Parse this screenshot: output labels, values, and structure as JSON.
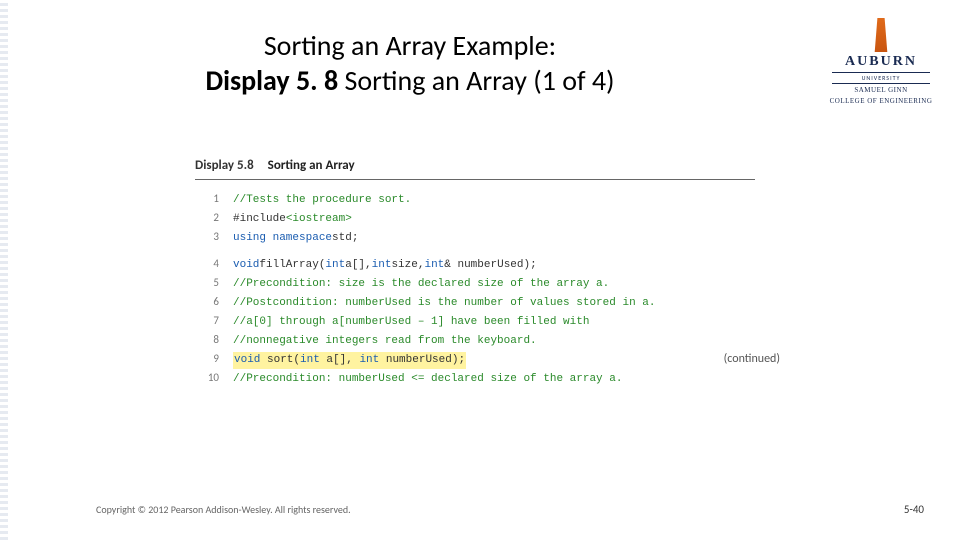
{
  "title": {
    "line1": "Sorting an Array Example:",
    "bold": "Display 5. 8",
    "rest": "  Sorting an Array (1 of 4)"
  },
  "logo": {
    "word": "AUBURN",
    "sub1": "UNIVERSITY",
    "sub2a": "SAMUEL GINN",
    "sub2b": "COLLEGE OF ENGINEERING"
  },
  "display": {
    "label": "Display 5.8",
    "name": "Sorting an Array"
  },
  "code": {
    "l1": "//Tests the procedure sort.",
    "l2a": "#include ",
    "l2b": "<iostream>",
    "l3a": "using namespace",
    "l3b": " std;",
    "l4a": "void",
    "l4b": " fillArray(",
    "l4c": "int",
    "l4d": " a[], ",
    "l4e": "int",
    "l4f": " size, ",
    "l4g": "int",
    "l4h": "& numberUsed);",
    "l5": "//Precondition: size is the declared size of the array a.",
    "l6": "//Postcondition: numberUsed is the number of values stored in a.",
    "l7": "//a[0] through a[numberUsed – 1] have been filled with",
    "l8": "//nonnegative integers read from the keyboard.",
    "l9a": "void",
    "l9b": " sort(",
    "l9c": "int",
    "l9d": " a[], ",
    "l9e": "int",
    "l9f": " numberUsed);",
    "l10": "//Precondition: numberUsed <= declared size of the array a."
  },
  "ln": {
    "n1": "1",
    "n2": "2",
    "n3": "3",
    "n4": "4",
    "n5": "5",
    "n6": "6",
    "n7": "7",
    "n8": "8",
    "n9": "9",
    "n10": "10"
  },
  "continued": "(continued)",
  "copyright": "Copyright © 2012 Pearson Addison-Wesley. All rights reserved.",
  "pagenum": "5-40"
}
